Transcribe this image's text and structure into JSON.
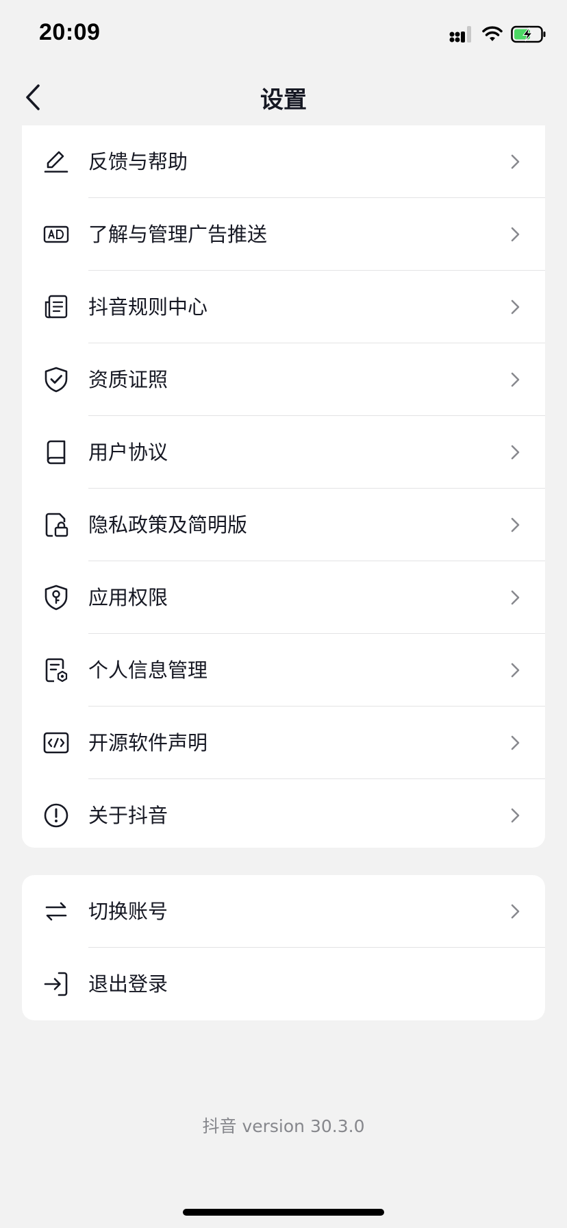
{
  "status_bar": {
    "time": "20:09"
  },
  "nav": {
    "title": "设置"
  },
  "settings_group_1": [
    {
      "label": "反馈与帮助",
      "icon": "edit-pen-icon"
    },
    {
      "label": "了解与管理广告推送",
      "icon": "ad-icon"
    },
    {
      "label": "抖音规则中心",
      "icon": "rules-document-icon"
    },
    {
      "label": "资质证照",
      "icon": "shield-check-icon"
    },
    {
      "label": "用户协议",
      "icon": "book-icon"
    },
    {
      "label": "隐私政策及简明版",
      "icon": "privacy-lock-icon"
    },
    {
      "label": "应用权限",
      "icon": "shield-key-icon"
    },
    {
      "label": "个人信息管理",
      "icon": "personal-info-icon"
    },
    {
      "label": "开源软件声明",
      "icon": "code-icon"
    },
    {
      "label": "关于抖音",
      "icon": "info-exclamation-icon"
    }
  ],
  "settings_group_2": [
    {
      "label": "切换账号",
      "icon": "switch-arrows-icon"
    },
    {
      "label": "退出登录",
      "icon": "logout-icon"
    }
  ],
  "footer": {
    "version": "抖音 version 30.3.0"
  },
  "colors": {
    "background": "#f2f2f2",
    "card": "#ffffff",
    "text": "#161823",
    "secondary_text": "#86878c",
    "battery_green": "#4cd964"
  }
}
